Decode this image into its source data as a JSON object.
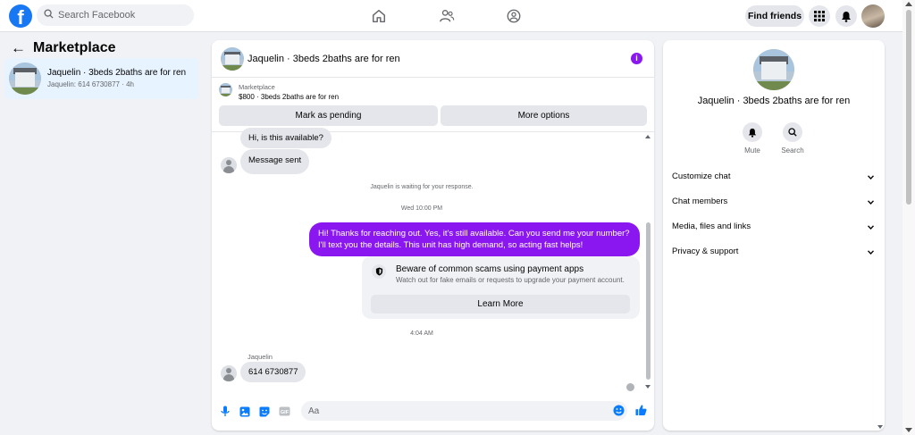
{
  "topbar": {
    "logo": "f",
    "search_placeholder": "Search Facebook",
    "find_friends_label": "Find friends",
    "icons": [
      "home-icon",
      "friends-icon",
      "groups-icon",
      "apps-grid-icon",
      "notifications-bell-icon",
      "profile-avatar"
    ]
  },
  "sidebar": {
    "back_arrow": "←",
    "title": "Marketplace",
    "conversations": [
      {
        "name": "Jaquelin · 3beds 2baths are for ren",
        "preview": "Jaquelin: 614 6730877 · 4h"
      }
    ]
  },
  "chat": {
    "title": "Jaquelin · 3beds 2baths are for ren",
    "info_glyph": "i",
    "listing": {
      "label": "Marketplace",
      "price_line": "$800 · 3beds 2baths are for ren",
      "mark_pending_label": "Mark as pending",
      "more_options_label": "More options"
    },
    "messages": {
      "auto_question": "Hi, is this available?",
      "sent_notice": "Message sent",
      "waiting_notice": "Jaquelin is waiting for your response.",
      "timestamp_1": "Wed 10:00 PM",
      "outgoing": "Hi! Thanks for reaching out. Yes, it's still available. Can you send me your number? I'll text you the details. This unit has high demand, so acting fast helps!",
      "scam_title": "Beware of common scams using payment apps",
      "scam_subtitle": "Watch out for fake emails or requests to upgrade your payment account.",
      "learn_more_label": "Learn More",
      "timestamp_2": "4:04 AM",
      "reply_sender": "Jaquelin",
      "reply_text": "614 6730877"
    },
    "composer": {
      "placeholder": "Aa",
      "icons": [
        "microphone-icon",
        "photo-icon",
        "sticker-icon",
        "gif-icon",
        "emoji-icon",
        "thumbs-up-icon"
      ],
      "gif_label": "GIF"
    }
  },
  "right_panel": {
    "title": "Jaquelin · 3beds 2baths are for ren",
    "actions": [
      {
        "label": "Mute",
        "icon": "bell-icon"
      },
      {
        "label": "Search",
        "icon": "search-icon"
      }
    ],
    "sections": [
      "Customize chat",
      "Chat members",
      "Media, files and links",
      "Privacy & support"
    ]
  },
  "colors": {
    "facebook_blue": "#1877f2",
    "outgoing_bubble": "#8a17f0",
    "selected_row": "#e7f3ff",
    "page_bg": "#f0f2f5"
  }
}
